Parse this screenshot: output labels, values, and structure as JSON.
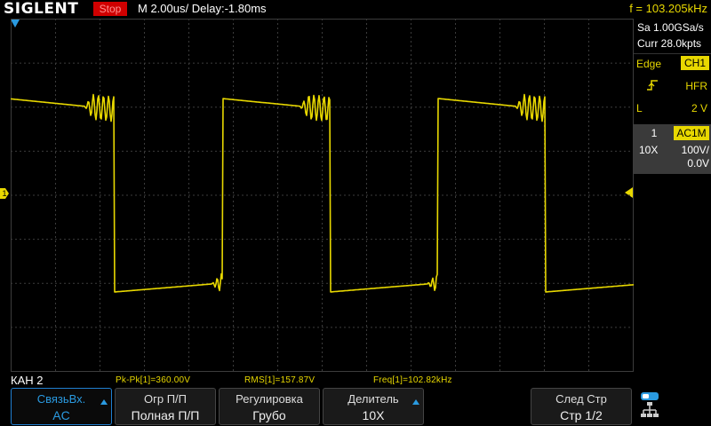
{
  "topbar": {
    "logo": "SIGLENT",
    "state": "Stop",
    "timebase": "M 2.00us/",
    "delay": "Delay:-1.80ms",
    "frequency": "f = 103.205kHz"
  },
  "right_panel": {
    "sample_rate": "Sa 1.00GSa/s",
    "memory": "Curr 28.0kpts",
    "trigger": {
      "type": "Edge",
      "source": "CH1",
      "coupling": "HFR",
      "level_label": "L",
      "level": "2 V"
    },
    "channel": {
      "number": "1",
      "coupling": "AC1M",
      "probe": "10X",
      "scale": "100V/",
      "offset": "0.0V"
    }
  },
  "markers": {
    "channel_marker": "1"
  },
  "status": {
    "channel": "КАН 2",
    "measurements": [
      "Pk-Pk[1]=360.00V",
      "RMS[1]=157.87V",
      "Freq[1]=102.82kHz"
    ]
  },
  "softkeys": [
    {
      "line1": "СвязьВх.",
      "line2": "AC"
    },
    {
      "line1": "Огр П/П",
      "line2": "Полная П/П"
    },
    {
      "line1": "Регулировка",
      "line2": "Грубо"
    },
    {
      "line1": "Делитель",
      "line2": "10X"
    },
    {
      "line1": "",
      "line2": ""
    },
    {
      "line1": "След Стр",
      "line2": "Стр 1/2"
    }
  ],
  "colors": {
    "trace": "#e8d800",
    "grid": "#3c3c3c",
    "accent": "#2a9ae0",
    "stop": "#d00000"
  },
  "icons": {
    "trigger_slope": "rising-edge-icon",
    "system": "network-icon"
  },
  "waveform": {
    "period_divisions": 4.85,
    "high_level_volts": 180,
    "low_level_volts": -180
  }
}
